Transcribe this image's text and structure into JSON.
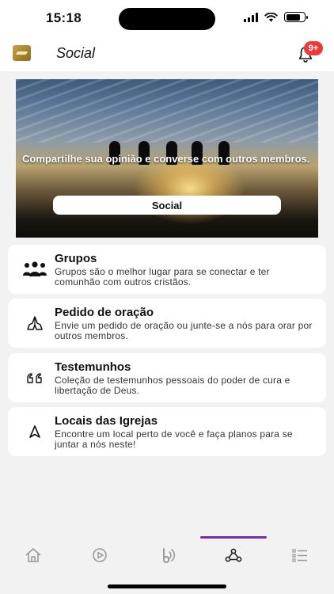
{
  "status_bar": {
    "time": "15:18"
  },
  "header": {
    "title": "Social",
    "notification_badge": "9+"
  },
  "banner": {
    "text": "Compartilhe sua opinião e converse com outros membros.",
    "button_label": "Social"
  },
  "cards": [
    {
      "title": "Grupos",
      "description": "Grupos são o melhor lugar para se conectar e ter comunhão com outros cristãos.",
      "icon": "people-group-icon"
    },
    {
      "title": "Pedido de oração",
      "description": "Envie um pedido de oração ou junte-se a nós para orar por outros membros.",
      "icon": "praying-hands-icon"
    },
    {
      "title": "Testemunhos",
      "description": "Coleção de testemunhos pessoais do poder de cura e libertação de Deus.",
      "icon": "quote-icon"
    },
    {
      "title": "Locais das Igrejas",
      "description": "Encontre um local perto de você e faça planos para se juntar a nós neste!",
      "icon": "navigation-arrow-icon"
    }
  ],
  "tab_bar": {
    "tabs": [
      "home-icon",
      "play-icon",
      "bible-icon",
      "social-icon",
      "list-icon"
    ],
    "active_index": 3,
    "accent_color": "#7a2ea6"
  },
  "colors": {
    "badge": "#ea3a3a",
    "background": "#f2f2f2",
    "card": "#ffffff"
  }
}
